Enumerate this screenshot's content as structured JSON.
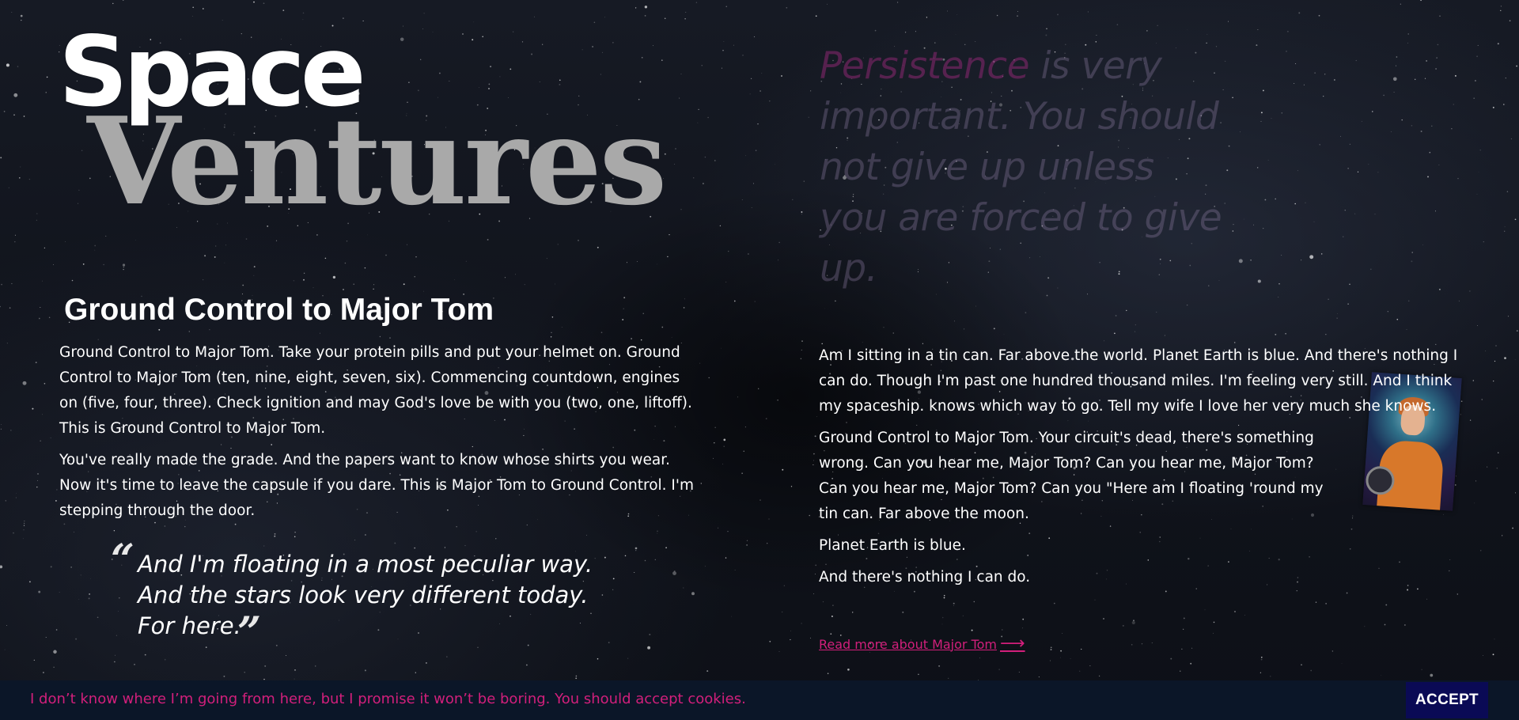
{
  "logo": {
    "line1": "Space",
    "line2": "Ventures"
  },
  "article": {
    "title": "Ground Control to Major Tom",
    "paragraphs": [
      "Ground Control to Major Tom. Take your protein pills and put your helmet on. Ground Control to Major Tom (ten, nine, eight, seven, six). Commencing countdown, engines on (five, four, three). Check ignition and may God's love be with you (two, one, liftoff). This is Ground Control to Major Tom.",
      "You've really made the grade. And the papers want to know whose shirts you wear. Now it's time to leave the capsule if you dare. This is Major Tom to Ground Control. I'm stepping through the door."
    ]
  },
  "quote": {
    "open_mark": "“",
    "close_mark": "”",
    "lines": [
      "And I'm floating in a most peculiar way.",
      "And the stars look very different today.",
      "For here."
    ]
  },
  "motto": {
    "highlight": "Persistence",
    "rest": " is very important. You should not give up unless you are forced to give up."
  },
  "right_article": {
    "paragraphs": [
      "Am I sitting in a tin can. Far above the world. Planet Earth is blue. And there's nothing I can do. Though I'm past one hundred thousand miles. I'm feeling very still. And I think my spaceship. knows which way to go. Tell my wife I love her very much she knows.",
      "Ground Control to Major Tom. Your circuit's dead, there's something wrong. Can you hear me, Major Tom? Can you hear me, Major Tom? Can you hear me, Major Tom? Can you \"Here am I floating 'round my tin can. Far above the moon.",
      "Planet Earth is blue.",
      "And there's nothing I can do."
    ],
    "read_more": "Read more about Major Tom",
    "read_more_arrow": "⟶"
  },
  "cookie": {
    "message": "I don’t know where I’m going from here, but I promise it won’t be boring. You should accept cookies.",
    "accept_label": "ACCEPT"
  },
  "colors": {
    "accent": "#d21f7b",
    "cookie_bar_bg": "#0b1628",
    "accept_bg": "#0a0a55"
  }
}
